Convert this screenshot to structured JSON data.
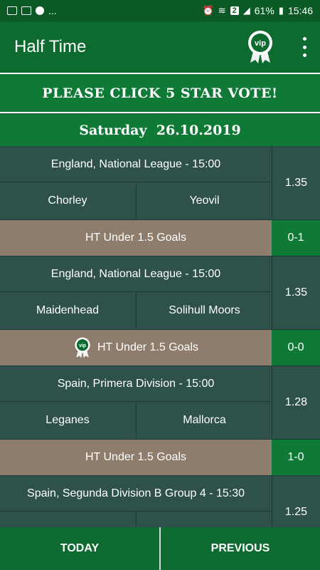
{
  "status_bar": {
    "battery": "61%",
    "time": "15:46",
    "notif_more": "...",
    "badge": "2"
  },
  "app": {
    "title": "Half Time",
    "vip_label": "vip"
  },
  "banner": {
    "text": "PLEASE CLICK 5 STAR VOTE!"
  },
  "date_header": {
    "text": "Saturday  26.10.2019"
  },
  "matches": [
    {
      "league": "England, National League - 15:00",
      "home": "Chorley",
      "away": "Yeovil",
      "odds": "1.35",
      "tip": "HT Under 1.5 Goals",
      "result": "0-1",
      "vip": false
    },
    {
      "league": "England, National League - 15:00",
      "home": "Maidenhead",
      "away": "Solihull Moors",
      "odds": "1.35",
      "tip": "HT Under 1.5 Goals",
      "result": "0-0",
      "vip": true
    },
    {
      "league": "Spain, Primera Division - 15:00",
      "home": "Leganes",
      "away": "Mallorca",
      "odds": "1.28",
      "tip": "HT Under 1.5 Goals",
      "result": "1-0",
      "vip": false
    },
    {
      "league": "Spain, Segunda Division B Group 4 - 15:30",
      "home": "",
      "away": "",
      "odds": "1.25",
      "tip": "",
      "result": "",
      "vip": false
    }
  ],
  "bottom_nav": {
    "today": "TODAY",
    "previous": "PREVIOUS"
  },
  "colors": {
    "primary_green": "#0d6b30",
    "accent_green": "#0f7a36",
    "row_teal": "#2e524b",
    "tip_brown": "#8e7d6c"
  }
}
